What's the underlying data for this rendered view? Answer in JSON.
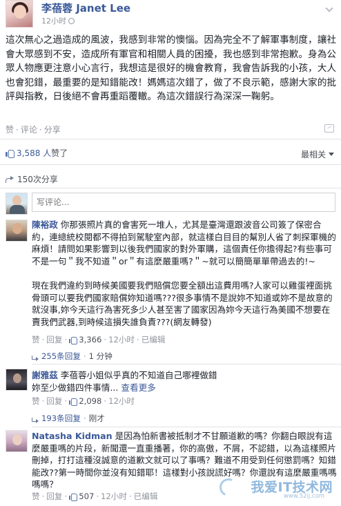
{
  "post": {
    "author": "李蓓蓉 Janet Lee",
    "time": "12小时",
    "text": "這次無心之過造成的風波，我感到非常的懊惱。因為完全不了解軍事制度，讓社會大眾感到不安，造成所有軍官和相關人員的困擾，我也感到非常抱歉。身為公眾人物應更注意小心言行，我想這是很好的機會教育，我會告訴我的小孩，大人也會犯錯，最重要的是知錯能改！媽媽這次錯了，做了不良示範，感謝大家的批評與指教，日後絕不會再重蹈覆轍。為這次錯誤行為深深一鞠躬。",
    "actions": {
      "like": "赞",
      "comment": "评论",
      "share": "分享"
    },
    "likes": {
      "count": "3,588 人",
      "suffix": "赞了"
    },
    "sort_label": "最相关",
    "shares": "150次分享"
  },
  "composer": {
    "placeholder": "写评论..."
  },
  "comments": [
    {
      "name": "陳裕政",
      "text": "你那張照片真的會害死一堆人，尤其是臺灣還跟波音公司簽了保密合約，連總統校閱都不得拍到駕駛室內部，就這樣白目目的幫別人省了刺探軍機的麻煩！請問如果影響到以後我們國家的對外軍購，這個責任你擔得起?有些事可不是一句＂我不知道＂or＂有這麼嚴重嗎?＂~就可以簡簡單單帶過去的!~",
      "text2": "現在我們違約到時候美國要我們賠償您要全額出這費用嗎?人家可以雞蛋裡面挑骨頭可以要我們國家賠償妳知道嗎???很多事情不是說妳不知道或妳不是故意的就沒事,妳今天這行為害死多少人甚至害了國家因為妳今天這行為美國不想要在賣我們武器,到時候這損失誰負責???(網友轉發)",
      "like": "赞",
      "reply": "回复",
      "likes": "3,366",
      "time": "12小时",
      "status": "已编辑",
      "replies": "255条回复",
      "reply_time": "1 分钟"
    },
    {
      "name": "謝雅茲",
      "text": "李蓓蓉小姐似乎真的不知道自己哪裡做錯",
      "text2": "妳至少做錯四件事情...",
      "more": "查看更多",
      "like": "赞",
      "reply": "回复",
      "likes": "2,098",
      "time": "12小时",
      "replies": "193条回复",
      "reply_time": "刚才"
    },
    {
      "name": "Natasha Kidman",
      "text": "是因為怕新書被抵制才不甘願道歉的嗎？你翻白眼說有這麼嚴重嗎的片段，新聞還一直重播著，你的高傲，不屑，不認錯，以為這樣照片刪掉，打打這種沒誠意的道歉文就可以了事嗎？難道不用受到任何懲罰嗎？知錯能改??第一時間你並沒有知錯耶！這樣對小孩說謊好嗎？你還說有這麼嚴重嗎嗎嗎嗎？",
      "like": "赞",
      "reply": "回复",
      "likes": "507",
      "time": "12小时",
      "status": "已编辑"
    }
  ],
  "watermark": {
    "title": "我爱IT技术网",
    "url": "www.52ij.com"
  }
}
